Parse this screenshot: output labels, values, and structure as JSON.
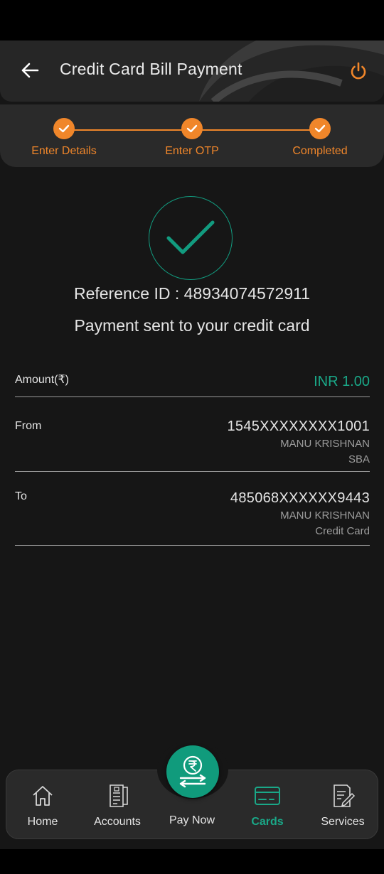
{
  "header": {
    "title": "Credit Card Bill Payment",
    "back_icon": "arrow-left-icon",
    "power_icon": "power-icon"
  },
  "stepper": {
    "steps": [
      {
        "label": "Enter Details",
        "done": true
      },
      {
        "label": "Enter OTP",
        "done": true
      },
      {
        "label": "Completed",
        "done": true
      }
    ]
  },
  "result": {
    "reference_id": "Reference ID : 48934074572911",
    "message": "Payment sent to your credit card"
  },
  "details": {
    "amount": {
      "label": "Amount(₹)",
      "value": "INR 1.00"
    },
    "from": {
      "label": "From",
      "account": "1545XXXXXXXX1001",
      "name": "MANU KRISHNAN",
      "type": "SBA"
    },
    "to": {
      "label": "To",
      "account": "485068XXXXXX9443",
      "name": "MANU KRISHNAN",
      "type": "Credit Card"
    }
  },
  "nav": {
    "home": "Home",
    "accounts": "Accounts",
    "pay_now": "Pay Now",
    "cards": "Cards",
    "services": "Services",
    "active": "cards"
  },
  "colors": {
    "accent_orange": "#f0862a",
    "accent_green": "#1aa888",
    "background": "#161616"
  }
}
